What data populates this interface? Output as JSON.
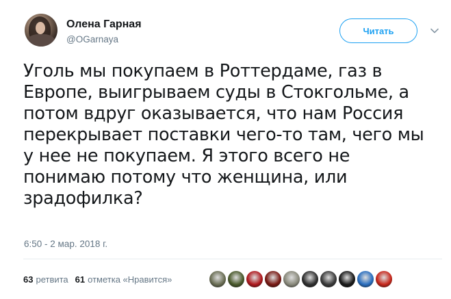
{
  "author": {
    "name": "Олена Гарная",
    "handle": "@OGarnaya"
  },
  "follow_button": {
    "label": "Читать"
  },
  "tweet_text": "Уголь мы покупаем в Роттердаме, газ в\nЕвропе, выигрываем суды в Стокгольме, а\nпотом вдруг оказывается, что нам Россия\nперекрывает поставки чего-то там, чего мы\nу нее не покупаем.  Я этого всего не\nпонимаю  потому что женщина, или\nзрадофилка?",
  "timestamp": "6:50 - 2 мар. 2018 г.",
  "stats": {
    "retweets_count": "63",
    "retweets_label": "ретвита",
    "likes_count": "61",
    "likes_label": "отметка «Нравится»"
  },
  "likers": [
    {
      "name": "liker-1",
      "color": "#6b6f55"
    },
    {
      "name": "liker-2",
      "color": "#4a5a2c"
    },
    {
      "name": "liker-3",
      "color": "#b0191e"
    },
    {
      "name": "liker-4",
      "color": "#7a1a14"
    },
    {
      "name": "liker-5",
      "color": "#8a8a7c"
    },
    {
      "name": "liker-6",
      "color": "#2f2f2f"
    },
    {
      "name": "liker-7",
      "color": "#3a3a3a"
    },
    {
      "name": "liker-8",
      "color": "#1a1a1a"
    },
    {
      "name": "liker-9",
      "color": "#2a6fc0"
    },
    {
      "name": "liker-10",
      "color": "#c8281c"
    }
  ]
}
